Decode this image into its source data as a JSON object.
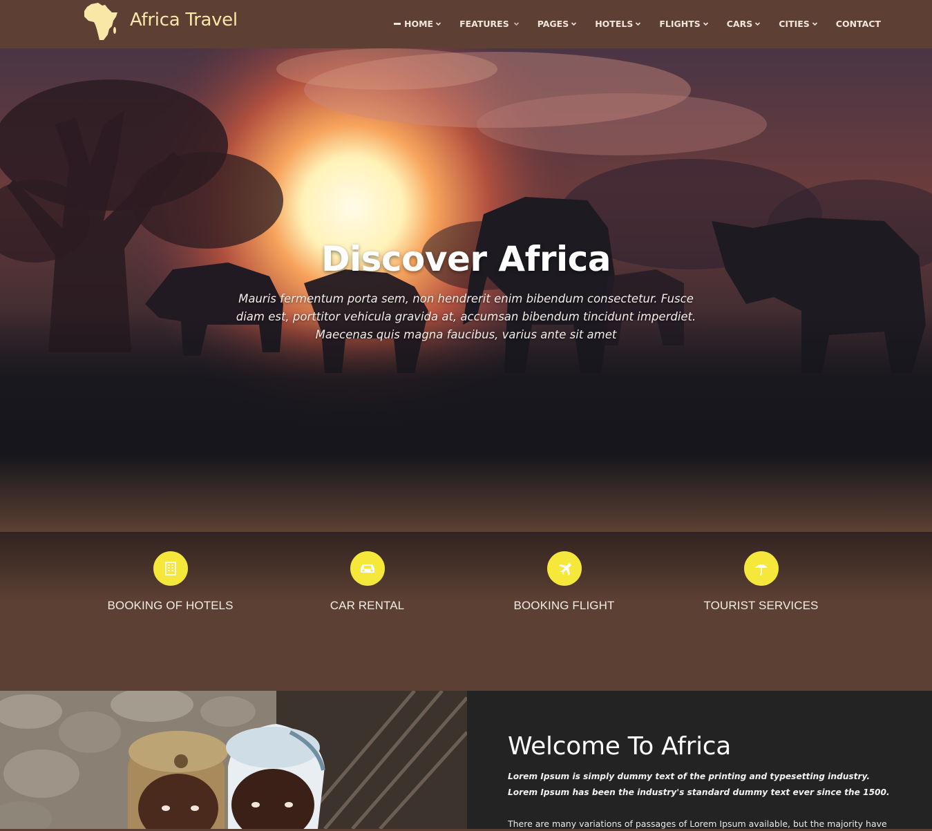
{
  "header": {
    "brand": "Africa Travel",
    "nav": [
      {
        "label": "HOME"
      },
      {
        "label": "FEATURES"
      },
      {
        "label": "PAGES"
      },
      {
        "label": "HOTELS"
      },
      {
        "label": "FLIGHTS"
      },
      {
        "label": "CARS"
      },
      {
        "label": "CITIES"
      },
      {
        "label": "CONTACT"
      }
    ]
  },
  "hero": {
    "title": "Discover Africa",
    "subtitle": "Mauris fermentum porta sem, non hendrerit enim bibendum consectetur. Fusce diam est, porttitor vehicula gravida at, accumsan bibendum tincidunt imperdiet. Maecenas quis magna faucibus, varius ante sit amet"
  },
  "services": [
    {
      "label": "BOOKING OF HOTELS",
      "icon": "hotel-icon"
    },
    {
      "label": "CAR RENTAL",
      "icon": "car-icon"
    },
    {
      "label": "BOOKING FLIGHT",
      "icon": "plane-icon"
    },
    {
      "label": "TOURIST SERVICES",
      "icon": "umbrella-icon"
    }
  ],
  "welcome": {
    "title": "Welcome To Africa",
    "lead": "Lorem Ipsum is simply dummy text of the printing and typesetting industry. Lorem Ipsum has been the industry's standard dummy text ever since the 1500.",
    "body": "There are many variations of passages of Lorem Ipsum available, but the majority have"
  },
  "colors": {
    "header_bg": "#5e3f33",
    "brand_text": "#f7e8a8",
    "accent_yellow": "#f5e83a",
    "services_bg": "#5c4033",
    "panel_bg": "#232323"
  }
}
